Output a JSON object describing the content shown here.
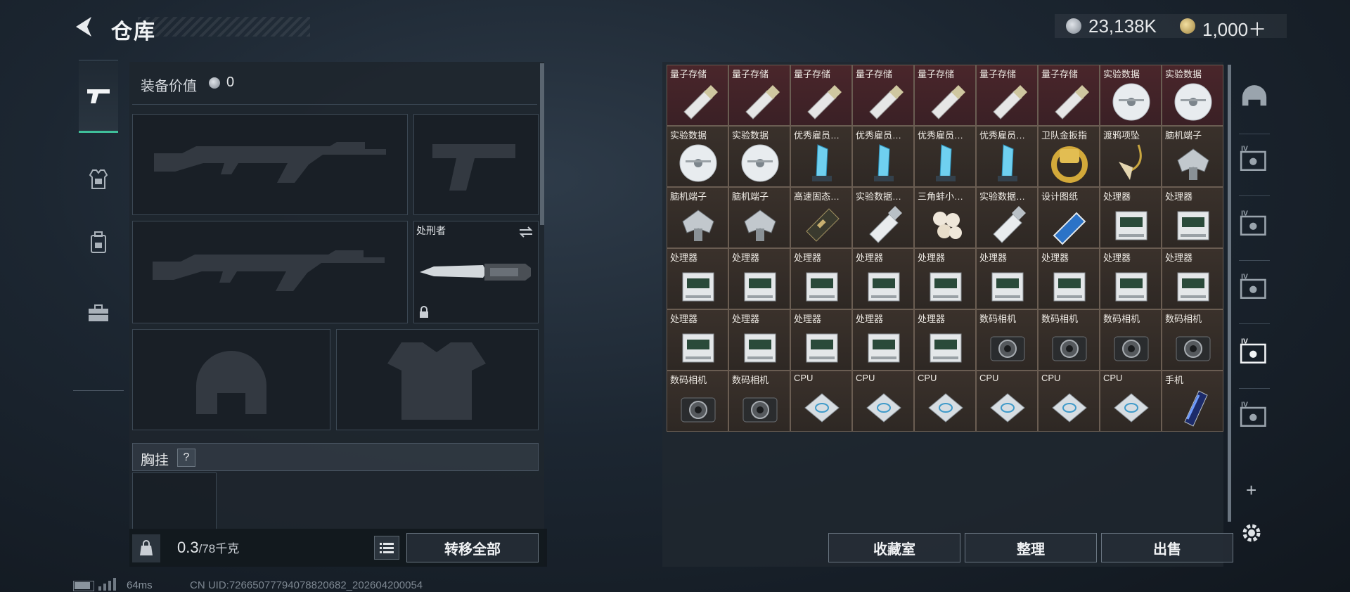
{
  "header": {
    "title": "仓库",
    "currency_silver": "23,138K",
    "currency_gold": "1,000＋"
  },
  "left_tabs": [
    {
      "name": "weapon",
      "icon": "pistol-icon",
      "active": true
    },
    {
      "name": "armor",
      "icon": "armor-icon",
      "active": false
    },
    {
      "name": "backpack",
      "icon": "backpack-icon",
      "active": false
    },
    {
      "name": "toolbox",
      "icon": "toolbox-icon",
      "active": false
    }
  ],
  "equipment": {
    "value_label": "装备价值",
    "value": "0",
    "melee_slot_name": "处刑者",
    "chest_rig_label": "胸挂",
    "chest_rig_help": "?",
    "weight_current": "0.3",
    "weight_max": "/78千克",
    "transfer_all_label": "转移全部"
  },
  "inventory": {
    "items": [
      {
        "label": "量子存储",
        "icon": "usb-drive-icon",
        "bg": "red"
      },
      {
        "label": "量子存储",
        "icon": "usb-drive-icon",
        "bg": "red"
      },
      {
        "label": "量子存储",
        "icon": "usb-drive-icon",
        "bg": "red"
      },
      {
        "label": "量子存储",
        "icon": "usb-drive-icon",
        "bg": "red"
      },
      {
        "label": "量子存储",
        "icon": "usb-drive-icon",
        "bg": "red"
      },
      {
        "label": "量子存储",
        "icon": "usb-drive-icon",
        "bg": "red"
      },
      {
        "label": "量子存储",
        "icon": "usb-drive-icon",
        "bg": "red"
      },
      {
        "label": "实验数据",
        "icon": "disc-icon",
        "bg": "red"
      },
      {
        "label": "实验数据",
        "icon": "disc-icon",
        "bg": "red"
      },
      {
        "label": "实验数据",
        "icon": "disc-icon",
        "bg": "brown"
      },
      {
        "label": "实验数据",
        "icon": "disc-icon",
        "bg": "brown"
      },
      {
        "label": "优秀雇员…",
        "icon": "crystal-trophy-icon",
        "bg": "brown"
      },
      {
        "label": "优秀雇员…",
        "icon": "crystal-trophy-icon",
        "bg": "brown"
      },
      {
        "label": "优秀雇员…",
        "icon": "crystal-trophy-icon",
        "bg": "brown"
      },
      {
        "label": "优秀雇员…",
        "icon": "crystal-trophy-icon",
        "bg": "brown"
      },
      {
        "label": "卫队金扳指",
        "icon": "gold-ring-icon",
        "bg": "brown"
      },
      {
        "label": "渡鸦项坠",
        "icon": "pendant-icon",
        "bg": "brown"
      },
      {
        "label": "脑机端子",
        "icon": "brain-terminal-icon",
        "bg": "brown"
      },
      {
        "label": "脑机端子",
        "icon": "brain-terminal-icon",
        "bg": "brown"
      },
      {
        "label": "脑机端子",
        "icon": "brain-terminal-icon",
        "bg": "brown"
      },
      {
        "label": "高速固态…",
        "icon": "ssd-icon",
        "bg": "brown"
      },
      {
        "label": "实验数据…",
        "icon": "data-drive-icon",
        "bg": "brown"
      },
      {
        "label": "三角蚌小…",
        "icon": "pearls-icon",
        "bg": "brown"
      },
      {
        "label": "实验数据…",
        "icon": "data-drive-icon",
        "bg": "brown"
      },
      {
        "label": "设计图纸",
        "icon": "blueprint-icon",
        "bg": "brown"
      },
      {
        "label": "处理器",
        "icon": "processor-module-icon",
        "bg": "brown"
      },
      {
        "label": "处理器",
        "icon": "processor-module-icon",
        "bg": "brown"
      },
      {
        "label": "处理器",
        "icon": "processor-module-icon",
        "bg": "brown"
      },
      {
        "label": "处理器",
        "icon": "processor-module-icon",
        "bg": "brown"
      },
      {
        "label": "处理器",
        "icon": "processor-module-icon",
        "bg": "brown"
      },
      {
        "label": "处理器",
        "icon": "processor-module-icon",
        "bg": "brown"
      },
      {
        "label": "处理器",
        "icon": "processor-module-icon",
        "bg": "brown"
      },
      {
        "label": "处理器",
        "icon": "processor-module-icon",
        "bg": "brown"
      },
      {
        "label": "处理器",
        "icon": "processor-module-icon",
        "bg": "brown"
      },
      {
        "label": "处理器",
        "icon": "processor-module-icon",
        "bg": "brown"
      },
      {
        "label": "处理器",
        "icon": "processor-module-icon",
        "bg": "brown"
      },
      {
        "label": "处理器",
        "icon": "processor-module-icon",
        "bg": "brown"
      },
      {
        "label": "处理器",
        "icon": "processor-module-icon",
        "bg": "brown"
      },
      {
        "label": "处理器",
        "icon": "processor-module-icon",
        "bg": "brown"
      },
      {
        "label": "处理器",
        "icon": "processor-module-icon",
        "bg": "brown"
      },
      {
        "label": "处理器",
        "icon": "processor-module-icon",
        "bg": "brown"
      },
      {
        "label": "数码相机",
        "icon": "camera-icon",
        "bg": "brown"
      },
      {
        "label": "数码相机",
        "icon": "camera-icon",
        "bg": "brown"
      },
      {
        "label": "数码相机",
        "icon": "camera-icon",
        "bg": "brown"
      },
      {
        "label": "数码相机",
        "icon": "camera-icon",
        "bg": "brown"
      },
      {
        "label": "数码相机",
        "icon": "camera-icon",
        "bg": "brown"
      },
      {
        "label": "数码相机",
        "icon": "camera-icon",
        "bg": "brown"
      },
      {
        "label": "CPU",
        "icon": "cpu-chip-icon",
        "bg": "brown"
      },
      {
        "label": "CPU",
        "icon": "cpu-chip-icon",
        "bg": "brown"
      },
      {
        "label": "CPU",
        "icon": "cpu-chip-icon",
        "bg": "brown"
      },
      {
        "label": "CPU",
        "icon": "cpu-chip-icon",
        "bg": "brown"
      },
      {
        "label": "CPU",
        "icon": "cpu-chip-icon",
        "bg": "brown"
      },
      {
        "label": "CPU",
        "icon": "cpu-chip-icon",
        "bg": "brown"
      },
      {
        "label": "手机",
        "icon": "smartphone-icon",
        "bg": "brown"
      }
    ],
    "collection_room_label": "收藏室",
    "sort_label": "整理",
    "sell_label": "出售",
    "add_label": "+"
  },
  "right_tabs": [
    {
      "icon": "helmet-vault-icon"
    },
    {
      "icon": "case-iv-icon"
    },
    {
      "icon": "case-iv-icon"
    },
    {
      "icon": "case-iv-icon"
    },
    {
      "icon": "case-iv-icon",
      "active": true
    },
    {
      "icon": "case-iv-icon"
    }
  ],
  "footer": {
    "ping": "64ms",
    "uid": "CN UID:7266507779407882068​2_202604200054"
  },
  "colors": {
    "accent": "#3fbf9a",
    "rare_item_bg": "#4a262b",
    "item_bg": "#3a312b"
  }
}
